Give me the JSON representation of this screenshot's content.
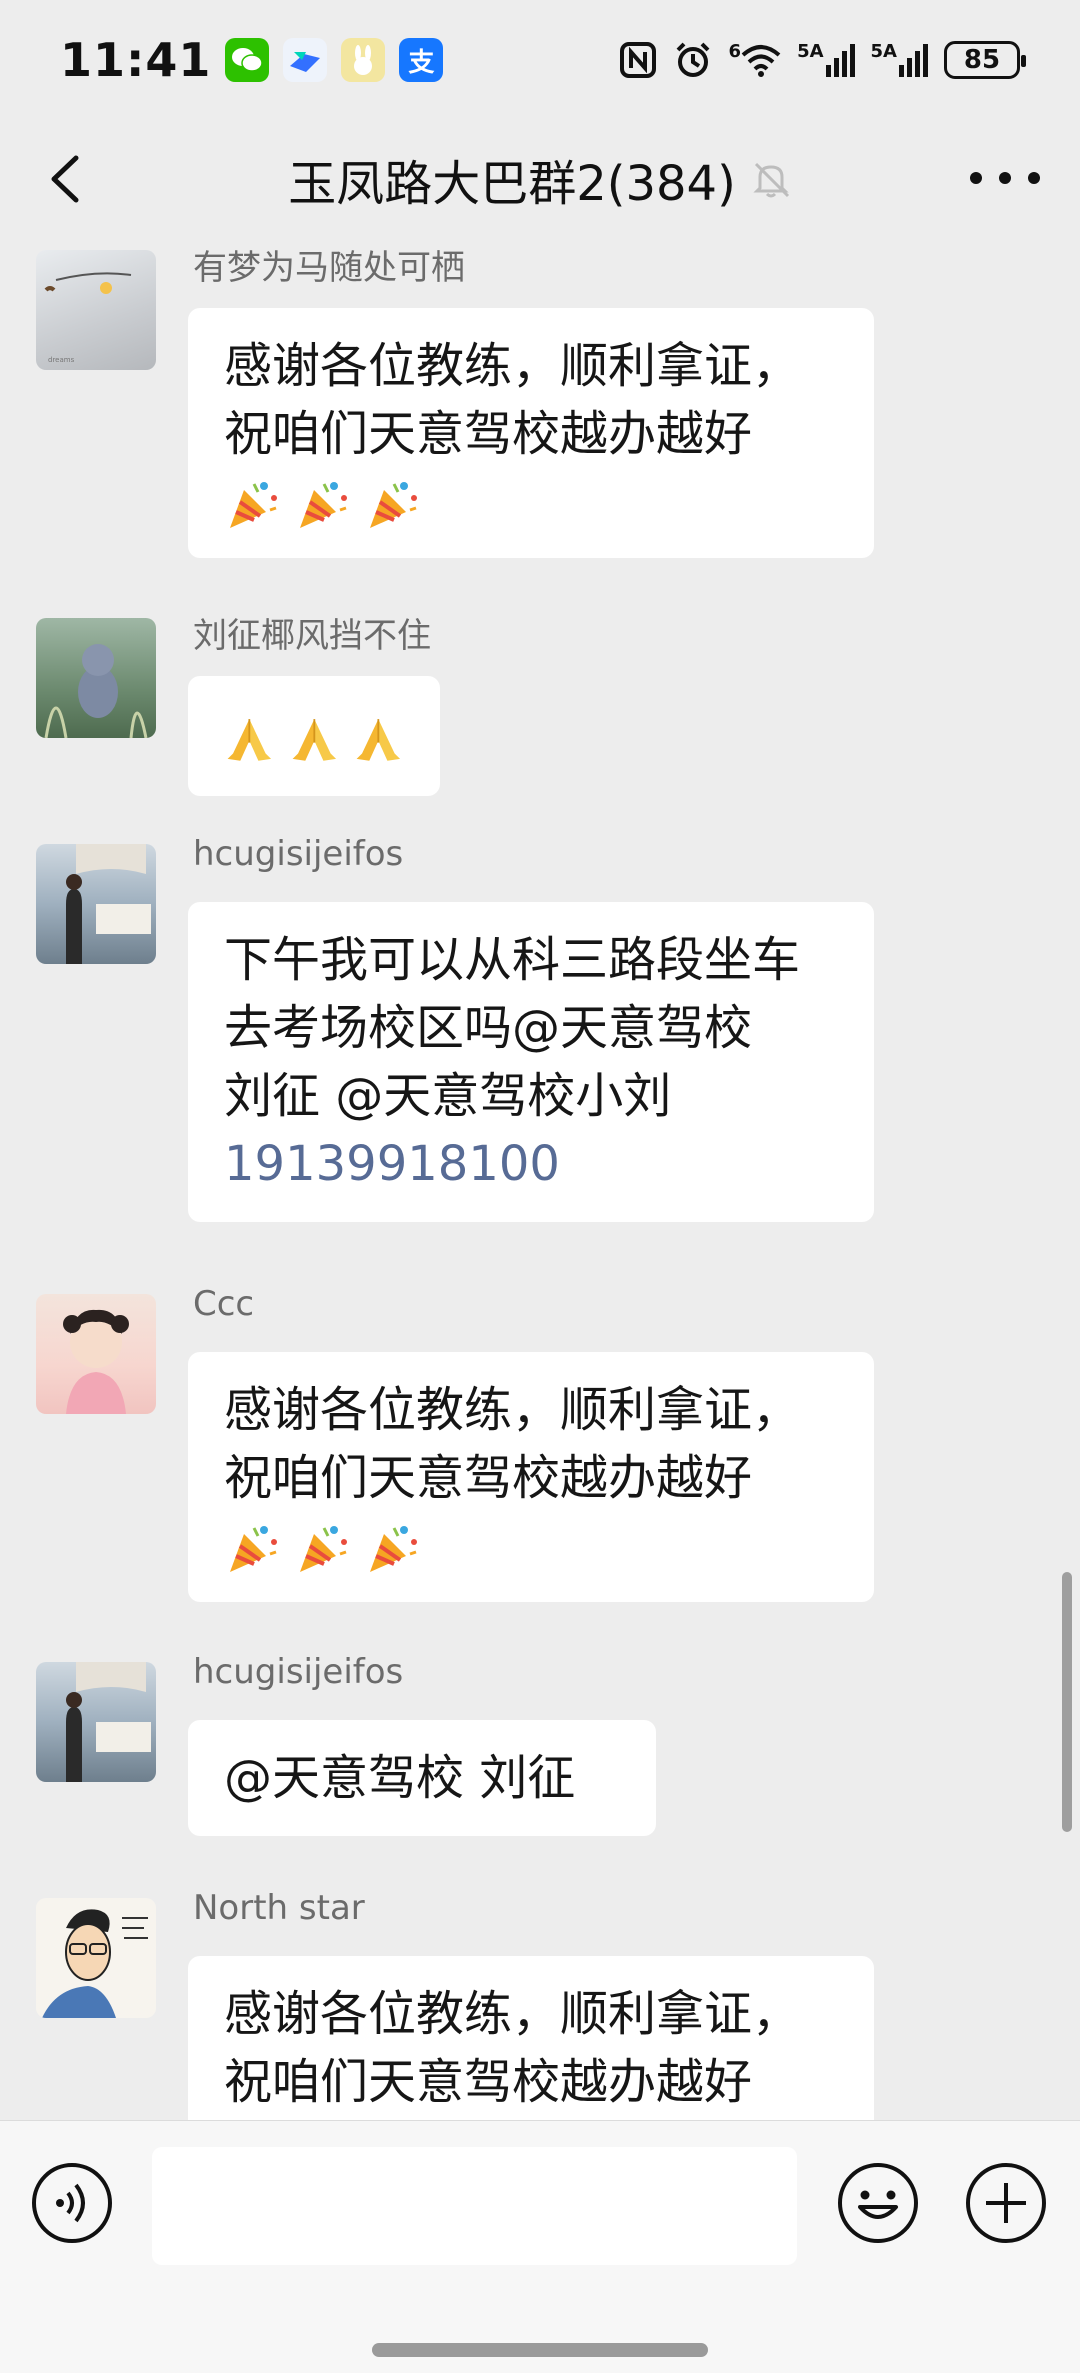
{
  "status_bar": {
    "time": "11:41",
    "apps": [
      "wechat-icon",
      "feishu-icon",
      "rabbit-app-icon",
      "alipay-icon"
    ],
    "alipay_glyph": "支",
    "indicators": [
      "nfc-icon",
      "alarm-icon",
      "wifi-icon",
      "5g-signal-icon",
      "5g-signal-icon"
    ],
    "wifi_label": "6",
    "sim1_label": "5A",
    "sim2_label": "5A",
    "battery": "85"
  },
  "header": {
    "title": "玉凤路大巴群2(384)",
    "muted": true
  },
  "messages": [
    {
      "sender": "有梦为马随处可栖",
      "lines": [
        "感谢各位教练，顺利拿证，",
        "祝咱们天意驾校越办越好"
      ],
      "emojis": [
        "party-popper",
        "party-popper",
        "party-popper"
      ]
    },
    {
      "sender": "刘征椰风挡不住",
      "lines": [],
      "emojis": [
        "pray",
        "pray",
        "pray"
      ]
    },
    {
      "sender": "hcugisijeifos",
      "lines": [
        "下午我可以从科三路段坐车",
        "去考场校区吗@天意驾校",
        "刘征 @天意驾校小刘"
      ],
      "phone": "19139918100"
    },
    {
      "sender": "Ccc",
      "lines": [
        "感谢各位教练，顺利拿证，",
        "祝咱们天意驾校越办越好"
      ],
      "emojis": [
        "party-popper",
        "party-popper",
        "party-popper"
      ]
    },
    {
      "sender": "hcugisijeifos",
      "lines": [
        "@天意驾校  刘征"
      ]
    },
    {
      "sender": "North star",
      "lines": [
        "感谢各位教练，顺利拿证，",
        "祝咱们天意驾校越办越好"
      ]
    }
  ],
  "input_bar": {
    "value": "",
    "placeholder": ""
  },
  "colors": {
    "background": "#ededed",
    "bubble": "#ffffff",
    "link": "#576b95",
    "sender": "#6b6b6b"
  }
}
